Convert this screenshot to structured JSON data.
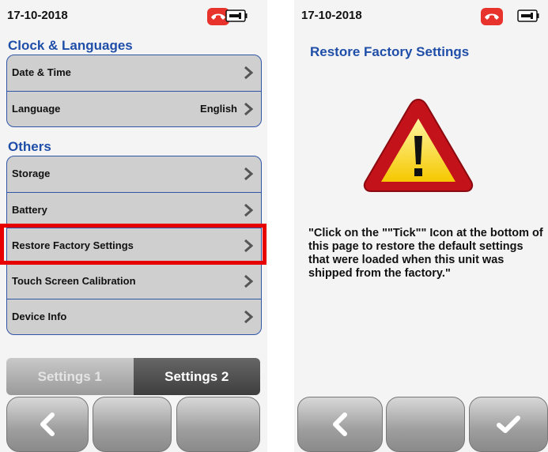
{
  "left": {
    "status": {
      "date": "17-10-2018"
    },
    "sections": [
      {
        "title": "Clock & Languages",
        "items": [
          {
            "label": "Date & Time",
            "value": ""
          },
          {
            "label": "Language",
            "value": "English"
          }
        ]
      },
      {
        "title": "Others",
        "items": [
          {
            "label": "Storage"
          },
          {
            "label": "Battery"
          },
          {
            "label": "Restore Factory Settings",
            "highlighted": true
          },
          {
            "label": "Touch Screen Calibration"
          },
          {
            "label": "Device Info"
          }
        ]
      }
    ],
    "tabs": [
      {
        "label": "Settings 1",
        "active": false
      },
      {
        "label": "Settings 2",
        "active": true
      }
    ],
    "softkeys": [
      "back-icon",
      "blank",
      "blank"
    ]
  },
  "right": {
    "status": {
      "date": "17-10-2018"
    },
    "title": "Restore Factory Settings",
    "icon": "warning-icon",
    "message": "\"Click on the \"\"Tick\"\" Icon at the bottom of this page to restore the default settings that were loaded when this unit was shipped from the factory.\"",
    "softkeys": [
      "back-icon",
      "blank",
      "tick-icon"
    ]
  },
  "colors": {
    "accent": "#1f4ea8",
    "highlight": "#e60000",
    "phone": "#e8332c"
  }
}
